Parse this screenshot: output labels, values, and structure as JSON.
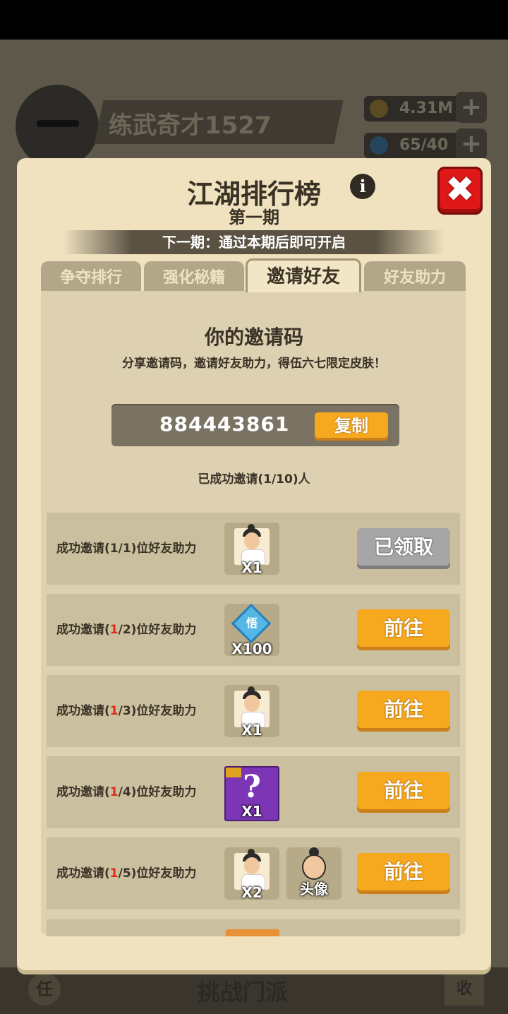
{
  "background": {
    "player_name": "练武奇才1527",
    "coins": "4.31M",
    "energy": "65/40",
    "plus": "+",
    "bottom_center": "挑战门派",
    "bottom_left": "任",
    "bottom_right": "收"
  },
  "panel": {
    "title": "江湖排行榜",
    "period": "第一期",
    "info": "i",
    "close": "✖",
    "next_period": "下一期：通过本期后即可开启"
  },
  "tabs": [
    {
      "label": "争夺排行",
      "active": false
    },
    {
      "label": "强化秘籍",
      "active": false
    },
    {
      "label": "邀请好友",
      "active": true
    },
    {
      "label": "好友助力",
      "active": false
    }
  ],
  "invite": {
    "heading": "你的邀请码",
    "description": "分享邀请码，邀请好友助力，得伍六七限定皮肤！",
    "code": "884443861",
    "copy_label": "复制",
    "invited_status": "已成功邀请(1/10)人"
  },
  "tasks": [
    {
      "prefix": "成功邀请(",
      "count": "1",
      "suffix": "/1)位好友助力",
      "count_red": false,
      "reward_qty": "X1",
      "button": "已领取"
    },
    {
      "prefix": "成功邀请(",
      "count": "1",
      "suffix": "/2)位好友助力",
      "count_red": true,
      "reward_qty": "X100",
      "reward_symbol": "悟",
      "button": "前往"
    },
    {
      "prefix": "成功邀请(",
      "count": "1",
      "suffix": "/3)位好友助力",
      "count_red": true,
      "reward_qty": "X1",
      "button": "前往"
    },
    {
      "prefix": "成功邀请(",
      "count": "1",
      "suffix": "/4)位好友助力",
      "count_red": true,
      "reward_qty": "X1",
      "reward_symbol": "?",
      "button": "前往"
    },
    {
      "prefix": "成功邀请(",
      "count": "1",
      "suffix": "/5)位好友助力",
      "count_red": true,
      "reward_qty": "X2",
      "reward2_label": "头像",
      "button": "前往"
    }
  ],
  "colors": {
    "panel_bg": "#f0e2bf",
    "accent_orange": "#f6a81f",
    "close_red": "#e01818",
    "claimed_gray": "#a6a6a6",
    "highlight_red": "#e02a1b"
  }
}
